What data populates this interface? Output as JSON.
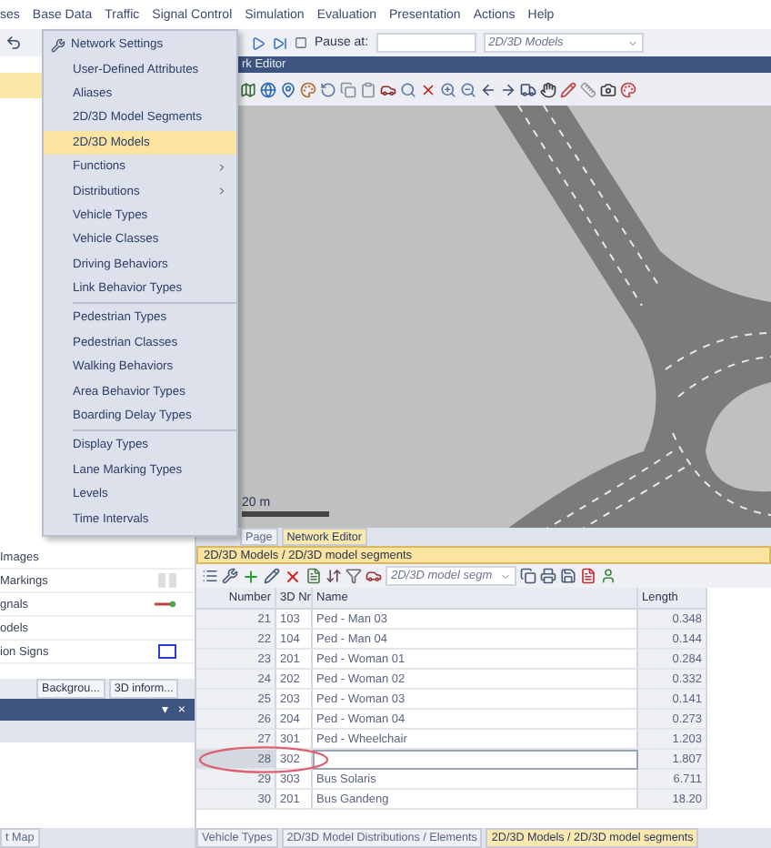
{
  "menu_bar": [
    "ses",
    "Base Data",
    "Traffic",
    "Signal Control",
    "Simulation",
    "Evaluation",
    "Presentation",
    "Actions",
    "Help"
  ],
  "toolbar": {
    "pause_label": "Pause at:",
    "view_select": "2D/3D Models"
  },
  "dropdown_menu": {
    "groups": [
      [
        {
          "label": "Network Settings",
          "has_submenu": false,
          "selected": false,
          "kind": "wrench"
        },
        {
          "label": "User-Defined Attributes",
          "has_submenu": false,
          "selected": false,
          "kind": "plain"
        },
        {
          "label": "Aliases",
          "has_submenu": false,
          "selected": false,
          "kind": "plain"
        },
        {
          "label": "2D/3D Model Segments",
          "has_submenu": false,
          "selected": false,
          "kind": "plain"
        },
        {
          "label": "2D/3D Models",
          "has_submenu": false,
          "selected": true,
          "kind": "plain"
        },
        {
          "label": "Functions",
          "has_submenu": true,
          "selected": false,
          "kind": "plain"
        },
        {
          "label": "Distributions",
          "has_submenu": true,
          "selected": false,
          "kind": "plain"
        },
        {
          "label": "Vehicle Types",
          "has_submenu": false,
          "selected": false,
          "kind": "plain"
        },
        {
          "label": "Vehicle Classes",
          "has_submenu": false,
          "selected": false,
          "kind": "plain"
        },
        {
          "label": "Driving Behaviors",
          "has_submenu": false,
          "selected": false,
          "kind": "plain"
        },
        {
          "label": "Link Behavior Types",
          "has_submenu": false,
          "selected": false,
          "kind": "plain"
        }
      ],
      [
        {
          "label": "Pedestrian Types",
          "has_submenu": false,
          "selected": false,
          "kind": "plain"
        },
        {
          "label": "Pedestrian Classes",
          "has_submenu": false,
          "selected": false,
          "kind": "plain"
        },
        {
          "label": "Walking Behaviors",
          "has_submenu": false,
          "selected": false,
          "kind": "plain"
        },
        {
          "label": "Area Behavior Types",
          "has_submenu": false,
          "selected": false,
          "kind": "plain"
        },
        {
          "label": "Boarding Delay Types",
          "has_submenu": false,
          "selected": false,
          "kind": "plain"
        }
      ],
      [
        {
          "label": "Display Types",
          "has_submenu": false,
          "selected": false,
          "kind": "plain"
        },
        {
          "label": "Lane Marking Types",
          "has_submenu": false,
          "selected": false,
          "kind": "plain"
        },
        {
          "label": "Levels",
          "has_submenu": false,
          "selected": false,
          "kind": "plain"
        },
        {
          "label": "Time Intervals",
          "has_submenu": false,
          "selected": false,
          "kind": "plain"
        }
      ]
    ]
  },
  "network_editor": {
    "title": "rk Editor",
    "scale": "20 m",
    "tabs": [
      {
        "label": "Page",
        "selected": false
      },
      {
        "label": "Network Editor",
        "selected": true
      }
    ]
  },
  "left_dock": {
    "items": [
      {
        "label": "Images",
        "kind": "none"
      },
      {
        "label": "Markings",
        "kind": "toggle"
      },
      {
        "label": "gnals",
        "kind": "line"
      },
      {
        "label": "odels",
        "kind": "none"
      },
      {
        "label": "ion Signs",
        "kind": "square"
      }
    ],
    "tabs": [
      "Backgrou...",
      "3D inform..."
    ],
    "bar_buttons": [
      "▾",
      "×"
    ],
    "lower_tab": "t Map"
  },
  "list_panel": {
    "title": "2D/3D Models / 2D/3D model segments",
    "view_select": "2D/3D model segm",
    "columns": [
      "Number",
      "3D Nr",
      "Name",
      "Length"
    ],
    "rows": [
      {
        "number": "21",
        "nr": "103",
        "name": "Ped - Man 03",
        "length": "0.348",
        "selected": false,
        "editing": false
      },
      {
        "number": "22",
        "nr": "104",
        "name": "Ped - Man 04",
        "length": "0.144",
        "selected": false,
        "editing": false
      },
      {
        "number": "23",
        "nr": "201",
        "name": "Ped - Woman 01",
        "length": "0.284",
        "selected": false,
        "editing": false
      },
      {
        "number": "24",
        "nr": "202",
        "name": "Ped - Woman 02",
        "length": "0.332",
        "selected": false,
        "editing": false
      },
      {
        "number": "25",
        "nr": "203",
        "name": "Ped - Woman 03",
        "length": "0.141",
        "selected": false,
        "editing": false
      },
      {
        "number": "26",
        "nr": "204",
        "name": "Ped - Woman 04",
        "length": "0.273",
        "selected": false,
        "editing": false
      },
      {
        "number": "27",
        "nr": "301",
        "name": "Ped - Wheelchair",
        "length": "1.203",
        "selected": false,
        "editing": false
      },
      {
        "number": "28",
        "nr": "302",
        "length": "1.807",
        "selected": true,
        "editing": true
      },
      {
        "number": "29",
        "nr": "303",
        "name": "Bus Solaris",
        "length": "6.711",
        "selected": false,
        "editing": false
      },
      {
        "number": "30",
        "nr": "201",
        "name": "Bus Gandeng",
        "length": "18.20",
        "selected": false,
        "editing": false
      }
    ]
  },
  "bottom_tabs": [
    {
      "label": "Vehicle Types",
      "selected": false
    },
    {
      "label": "2D/3D Model Distributions / Elements",
      "selected": false
    },
    {
      "label": "2D/3D Models / 2D/3D model segments",
      "selected": true
    }
  ]
}
